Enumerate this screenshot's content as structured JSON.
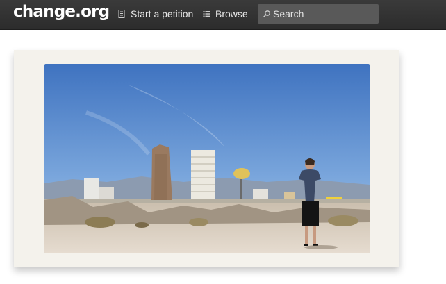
{
  "header": {
    "logo": "change.org",
    "nav": {
      "start_petition": "Start a petition",
      "browse": "Browse"
    },
    "search": {
      "placeholder": "Search"
    }
  },
  "photo": {
    "icon": "photo-image"
  },
  "colors": {
    "topbar": "#333333",
    "card_bg": "#f4f2ec",
    "sky": "#4a7fc8"
  }
}
